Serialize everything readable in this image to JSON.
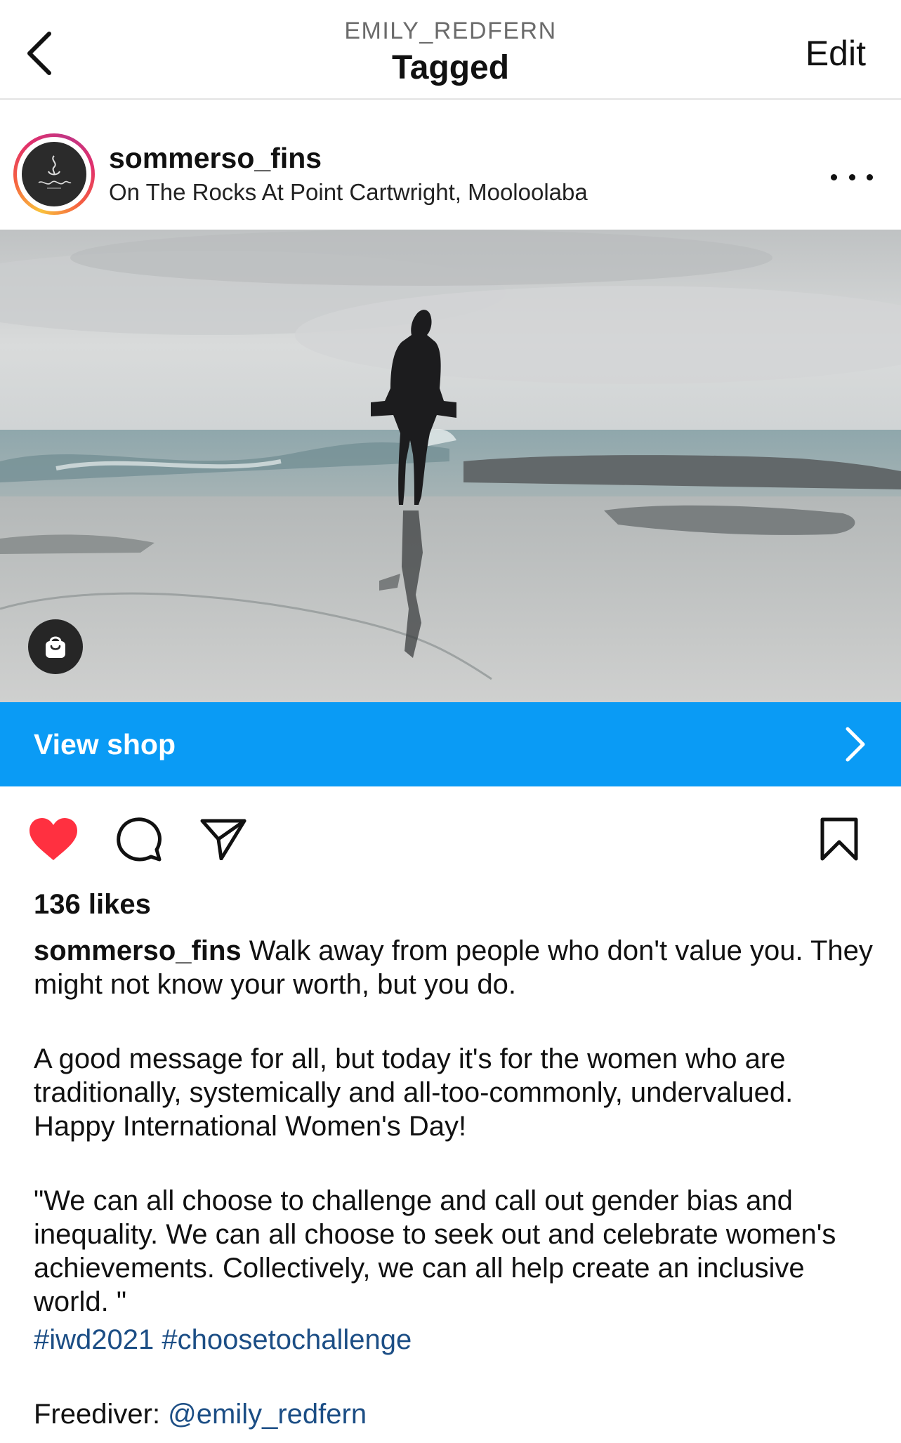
{
  "nav": {
    "username": "EMILY_REDFERN",
    "title": "Tagged",
    "edit_label": "Edit"
  },
  "post": {
    "username": "sommerso_fins",
    "location": "On The Rocks At Point Cartwright, Mooloolaba",
    "avatar_alt": "Sommerso"
  },
  "shop": {
    "label": "View shop"
  },
  "engagement": {
    "likes": "136 likes",
    "liked": true
  },
  "caption": {
    "username": "sommerso_fins",
    "line1": " Walk away from people who don't value you. They might not know your worth, but you do.",
    "para2": "A good message for all, but today it's for the women who are traditionally, systemically and all-too-commonly, undervalued. Happy International Women's Day!",
    "para3": "\"We can all choose to challenge and call out gender bias and inequality. We can all choose to seek out and celebrate women's achievements. Collectively, we can all help create an inclusive world. \"",
    "hashtag1": "#iwd2021",
    "hashtag2": "#choosetochallenge",
    "credit_prefix": "Freediver: ",
    "credit_mention": "@emily_redfern"
  },
  "colors": {
    "shop_bar": "#0a9bf5",
    "like_red": "#ff3040",
    "link": "#1c4e85"
  },
  "icons": [
    "back-chevron-icon",
    "more-dots-icon",
    "shopping-bag-icon",
    "chevron-right-icon",
    "heart-icon",
    "comment-icon",
    "share-icon",
    "bookmark-icon"
  ]
}
